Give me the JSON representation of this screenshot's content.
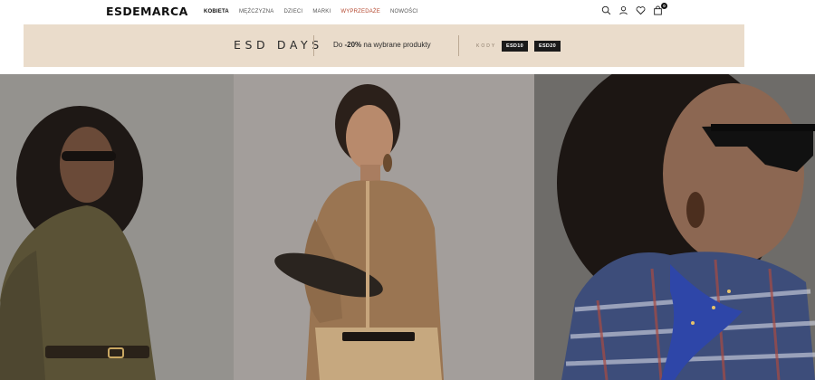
{
  "brand": {
    "name": "ESDEMARCA"
  },
  "nav": {
    "items": [
      {
        "label": "KOBIETA",
        "state": "active"
      },
      {
        "label": "MĘŻCZYZNA",
        "state": ""
      },
      {
        "label": "DZIECI",
        "state": ""
      },
      {
        "label": "MARKI",
        "state": ""
      },
      {
        "label": "WYPRZEDAŻE",
        "state": "sale"
      },
      {
        "label": "NOWOŚCI",
        "state": ""
      }
    ]
  },
  "header_icons": {
    "search": "search-icon",
    "account": "user-icon",
    "wishlist": "heart-icon",
    "cart": "bag-icon",
    "cart_count": "0"
  },
  "promo": {
    "title": "ESD DAYS",
    "text_prefix": "Do ",
    "discount": "-20%",
    "text_suffix": " na wybrane produkty",
    "codes_label": "KODY",
    "codes": [
      "ESD10",
      "ESD20"
    ]
  },
  "colors": {
    "promo_bg": "#eadccb",
    "sale_accent": "#b4472e",
    "code_bg": "#1a1a1a"
  }
}
